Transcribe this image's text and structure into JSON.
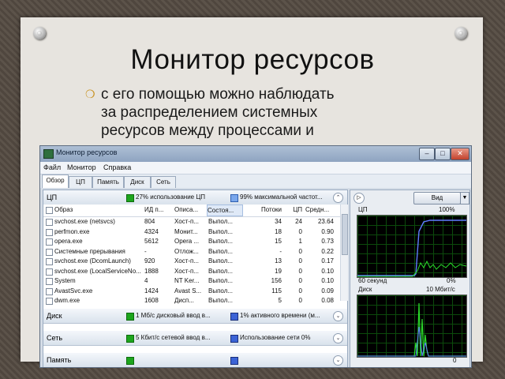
{
  "slide": {
    "title": "Монитор ресурсов",
    "bullet_lines": [
      "с его помощью можно наблюдать",
      "за распределением системных",
      "ресурсов между процессами и"
    ]
  },
  "window": {
    "title": "Монитор ресурсов",
    "menu": [
      "Файл",
      "Монитор",
      "Справка"
    ],
    "tabs": [
      "Обзор",
      "ЦП",
      "Память",
      "Диск",
      "Сеть"
    ],
    "active_tab": "Обзор",
    "cpu": {
      "title": "ЦП",
      "usage_text": "27% использование ЦП",
      "max_freq_text": "99% максимальной частот...",
      "columns": [
        "Образ",
        "ИД п...",
        "Описа...",
        "Состоя...",
        "Потоки",
        "ЦП",
        "Средн..."
      ],
      "rows": [
        {
          "name": "svchost.exe (netsvcs)",
          "pid": "804",
          "desc": "Хост-п...",
          "state": "Выпол...",
          "threads": "34",
          "cpu": "24",
          "avg": "23.64"
        },
        {
          "name": "perfmon.exe",
          "pid": "4324",
          "desc": "Монит...",
          "state": "Выпол...",
          "threads": "18",
          "cpu": "0",
          "avg": "0.90"
        },
        {
          "name": "opera.exe",
          "pid": "5612",
          "desc": "Opera ...",
          "state": "Выпол...",
          "threads": "15",
          "cpu": "1",
          "avg": "0.73"
        },
        {
          "name": "Системные прерывания",
          "pid": "-",
          "desc": "Отлож...",
          "state": "Выпол...",
          "threads": "-",
          "cpu": "0",
          "avg": "0.22"
        },
        {
          "name": "svchost.exe (DcomLaunch)",
          "pid": "920",
          "desc": "Хост-п...",
          "state": "Выпол...",
          "threads": "13",
          "cpu": "0",
          "avg": "0.17"
        },
        {
          "name": "svchost.exe (LocalServiceNo...",
          "pid": "1888",
          "desc": "Хост-п...",
          "state": "Выпол...",
          "threads": "19",
          "cpu": "0",
          "avg": "0.10"
        },
        {
          "name": "System",
          "pid": "4",
          "desc": "NT Ker...",
          "state": "Выпол...",
          "threads": "156",
          "cpu": "0",
          "avg": "0.10"
        },
        {
          "name": "AvastSvc.exe",
          "pid": "1424",
          "desc": "Avast S...",
          "state": "Выпол...",
          "threads": "115",
          "cpu": "0",
          "avg": "0.09"
        },
        {
          "name": "dwm.exe",
          "pid": "1608",
          "desc": "Дисп...",
          "state": "Выпол...",
          "threads": "5",
          "cpu": "0",
          "avg": "0.08"
        }
      ]
    },
    "disk": {
      "title": "Диск",
      "io_text": "1 Мб/с дисковый ввод в...",
      "active_text": "1% активного времени (м..."
    },
    "network": {
      "title": "Сеть",
      "io_text": "5 Кбит/с сетевой ввод в...",
      "usage_text": "Использование сети 0%"
    },
    "memory": {
      "title": "Память"
    },
    "side": {
      "view_label": "Вид",
      "cpu_label": "ЦП",
      "cpu_value": "100%",
      "cpu_time": "60 секунд",
      "cpu_min": "0%",
      "disk_label": "Диск",
      "disk_value": "10 Мбит/с",
      "disk_min": "0"
    }
  }
}
